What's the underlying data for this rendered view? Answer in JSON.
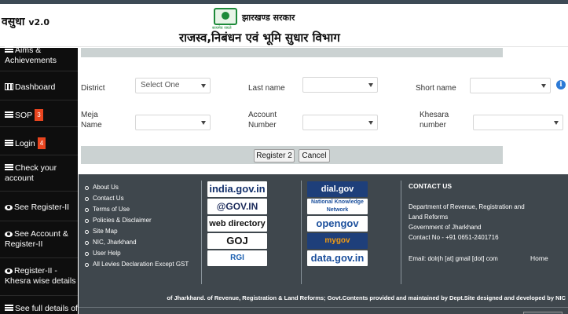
{
  "header": {
    "brand_name": "वसुधा",
    "brand_version": "v2.0",
    "state_name": "झारखण्ड सरकार",
    "emblem_caption": "सत्यमेव जयते",
    "department_title": "राजस्व,निबंधन एवं भूमि सुधार विभाग"
  },
  "sidebar": {
    "items": [
      {
        "label": "Aims & Achievements",
        "icon": "list-icon"
      },
      {
        "label": "Dashboard",
        "icon": "chart-icon"
      },
      {
        "label": "SOP",
        "badge": "3",
        "icon": "list-icon"
      },
      {
        "label": "Login",
        "badge": "4",
        "icon": "list-icon"
      },
      {
        "label": "Check your account",
        "icon": "list-icon"
      },
      {
        "label": "See Register-II",
        "icon": "eye-icon"
      },
      {
        "label": "See Account & Register-II",
        "icon": "eye-icon"
      },
      {
        "label": "Register-II - Khesra wise details",
        "icon": "eye-icon"
      },
      {
        "label": "See full details of",
        "icon": "list-icon"
      }
    ]
  },
  "form": {
    "district_label": "District",
    "district_value": "Select One",
    "last_name_label": "Last name",
    "last_name_value": "",
    "short_name_label": "Short name",
    "short_name_value": "",
    "meja_name_label": "Meja Name",
    "meja_name_value": "",
    "account_number_label": "Account Number",
    "account_number_value": "",
    "khesara_number_label": "Khesara number",
    "khesara_number_value": "",
    "register_button": "Register 2",
    "cancel_button": "Cancel"
  },
  "footer": {
    "links": [
      "About Us",
      "Contact Us",
      "Terms of Use",
      "Policies & Disclaimer",
      "Site Map",
      "NIC, Jharkhand",
      "User Help",
      "All Levies Declaration Except GST"
    ],
    "logos_col1": [
      "india.gov.in",
      "@GOV.IN",
      "web directory",
      "GOJ",
      "RGI"
    ],
    "logos_col2": [
      "dial.gov",
      "National Knowledge Network",
      "opengov",
      "mygov",
      "data.gov.in"
    ],
    "contact_title": "CONTACT US",
    "contact_lines": [
      "Department of Revenue, Registration and",
      "Land Reforms",
      "Government of Jharkhand",
      "Contact No - +91 0651-2401716"
    ],
    "email": "Email: dolrjh [at] gmail [dot] com",
    "home_label": "Home",
    "bottom_text": "of Jharkhand.  of Revenue, Registration & Land Reforms; Govt.Contents provided and maintained by Dept.Site designed and developed by NIC"
  },
  "colors": {
    "sidebar_bg": "#0e0e0e",
    "badge": "#e9451f",
    "footer_bg": "#3f474d",
    "info": "#2c7ad6"
  }
}
